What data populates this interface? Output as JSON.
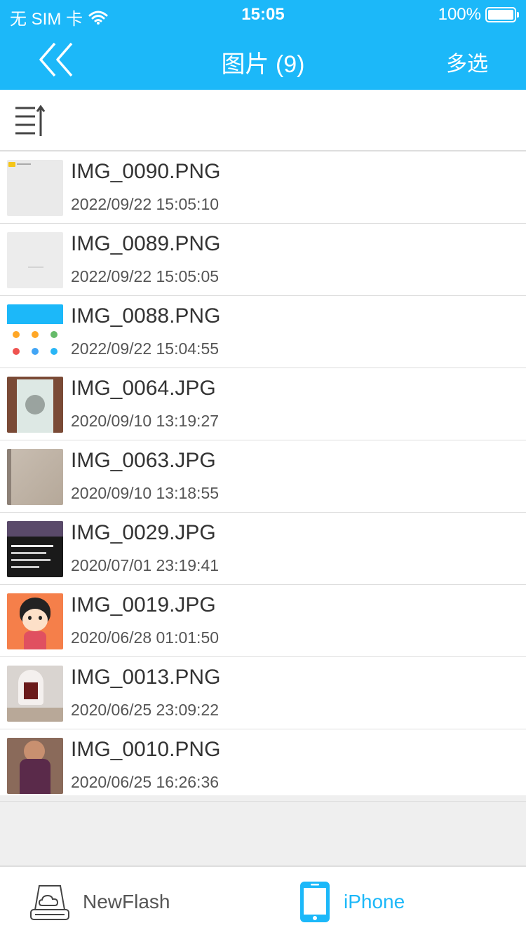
{
  "status": {
    "carrier": "无 SIM 卡",
    "time": "15:05",
    "battery": "100%"
  },
  "navbar": {
    "title": "图片 (9)",
    "multi_select": "多选"
  },
  "files": [
    {
      "name": "IMG_0090.PNG",
      "date": "2022/09/22 15:05:10"
    },
    {
      "name": "IMG_0089.PNG",
      "date": "2022/09/22 15:05:05"
    },
    {
      "name": "IMG_0088.PNG",
      "date": "2022/09/22 15:04:55"
    },
    {
      "name": "IMG_0064.JPG",
      "date": "2020/09/10 13:19:27"
    },
    {
      "name": "IMG_0063.JPG",
      "date": "2020/09/10 13:18:55"
    },
    {
      "name": "IMG_0029.JPG",
      "date": "2020/07/01 23:19:41"
    },
    {
      "name": "IMG_0019.JPG",
      "date": "2020/06/28 01:01:50"
    },
    {
      "name": "IMG_0013.PNG",
      "date": "2020/06/25 23:09:22"
    },
    {
      "name": "IMG_0010.PNG",
      "date": "2020/06/25 16:26:36"
    }
  ],
  "tabs": [
    {
      "label": "NewFlash",
      "active": false
    },
    {
      "label": "iPhone",
      "active": true
    }
  ],
  "colors": {
    "accent": "#1cb8f9",
    "text": "#333333",
    "inactive_tab": "#555555"
  }
}
